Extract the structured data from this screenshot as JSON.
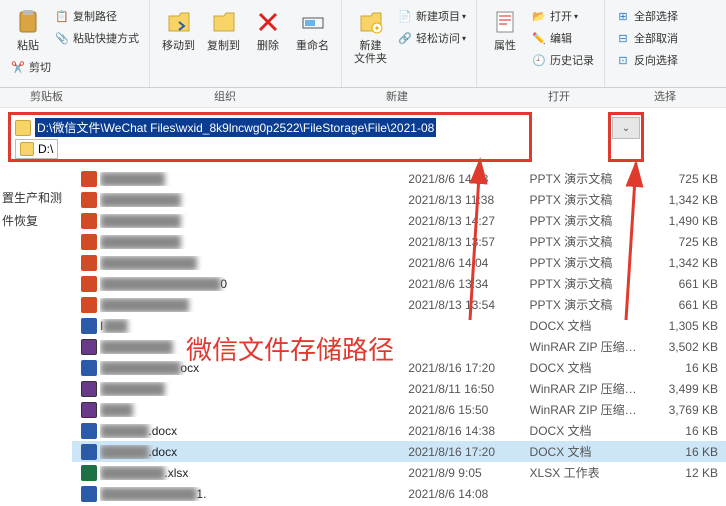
{
  "ribbon": {
    "clipboard": {
      "paste": "粘贴",
      "copy_path": "复制路径",
      "paste_shortcut": "粘贴快捷方式",
      "cut": "剪切",
      "group": "剪贴板"
    },
    "organize": {
      "move_to": "移动到",
      "copy_to": "复制到",
      "delete": "删除",
      "rename": "重命名",
      "group": "组织"
    },
    "new": {
      "new_folder": "新建\n文件夹",
      "new_item": "新建项目",
      "easy_access": "轻松访问",
      "group": "新建"
    },
    "open": {
      "properties": "属性",
      "open": "打开",
      "edit": "编辑",
      "history": "历史记录",
      "group": "打开"
    },
    "select": {
      "select_all": "全部选择",
      "select_none": "全部取消",
      "invert": "反向选择",
      "group": "选择"
    }
  },
  "address": {
    "path": "D:\\微信文件\\WeChat Files\\wxid_8k9lncwg0p2522\\FileStorage\\File\\2021-08",
    "suggestion": "D:\\"
  },
  "sidebar": {
    "item1": "置生产和测",
    "item2": "件恢复"
  },
  "annotation": "微信文件存储路径",
  "files": [
    {
      "icon": "pptx",
      "name_blur": "████████",
      "date": "2021/8/6 14:08",
      "type": "PPTX 演示文稿",
      "size": "725 KB"
    },
    {
      "icon": "pptx",
      "name_blur": "██████████",
      "date": "2021/8/13 11:38",
      "type": "PPTX 演示文稿",
      "size": "1,342 KB"
    },
    {
      "icon": "pptx",
      "name_blur": "██████████",
      "date": "2021/8/13 14:27",
      "type": "PPTX 演示文稿",
      "size": "1,490 KB"
    },
    {
      "icon": "pptx",
      "name_blur": "██████████",
      "date": "2021/8/13 13:57",
      "type": "PPTX 演示文稿",
      "size": "725 KB"
    },
    {
      "icon": "pptx",
      "name_blur": "████████████",
      "date": "2021/8/6 14:04",
      "type": "PPTX 演示文稿",
      "size": "1,342 KB"
    },
    {
      "icon": "pptx",
      "name_blur": "███████████████",
      "name_suffix": "0",
      "date": "2021/8/6 13:34",
      "type": "PPTX 演示文稿",
      "size": "661 KB"
    },
    {
      "icon": "pptx",
      "name_blur": "███████████",
      "date": "2021/8/13 13:54",
      "type": "PPTX 演示文稿",
      "size": "661 KB"
    },
    {
      "icon": "docx",
      "name_blur": "███",
      "name_prefix": "l",
      "date": "",
      "type": "DOCX 文档",
      "size": "1,305 KB"
    },
    {
      "icon": "rar",
      "name_blur": "█████████",
      "date": "",
      "type": "WinRAR ZIP 压缩…",
      "size": "3,502 KB"
    },
    {
      "icon": "docx",
      "name_blur": "██████████",
      "name_suffix": "ocx",
      "date": "2021/8/16 17:20",
      "type": "DOCX 文档",
      "size": "16 KB"
    },
    {
      "icon": "rar",
      "name_blur": "████████",
      "date": "2021/8/11 16:50",
      "type": "WinRAR ZIP 压缩…",
      "size": "3,499 KB"
    },
    {
      "icon": "rar",
      "name_blur": "████",
      "date": "2021/8/6 15:50",
      "type": "WinRAR ZIP 压缩…",
      "size": "3,769 KB"
    },
    {
      "icon": "docx",
      "name_blur": "██████",
      "name_suffix": ".docx",
      "date": "2021/8/16 14:38",
      "type": "DOCX 文档",
      "size": "16 KB"
    },
    {
      "icon": "docx",
      "name_blur": "██████",
      "name_suffix": ".docx",
      "date": "2021/8/16 17:20",
      "type": "DOCX 文档",
      "size": "16 KB",
      "sel": true
    },
    {
      "icon": "xlsx",
      "name_blur": "████████",
      "name_suffix": ".xlsx",
      "date": "2021/8/9 9:05",
      "type": "XLSX 工作表",
      "size": "12 KB"
    },
    {
      "icon": "docx",
      "name_blur": "████████████",
      "name_suffix": "1.",
      "date": "2021/8/6 14:08",
      "type": "",
      "size": ""
    }
  ]
}
